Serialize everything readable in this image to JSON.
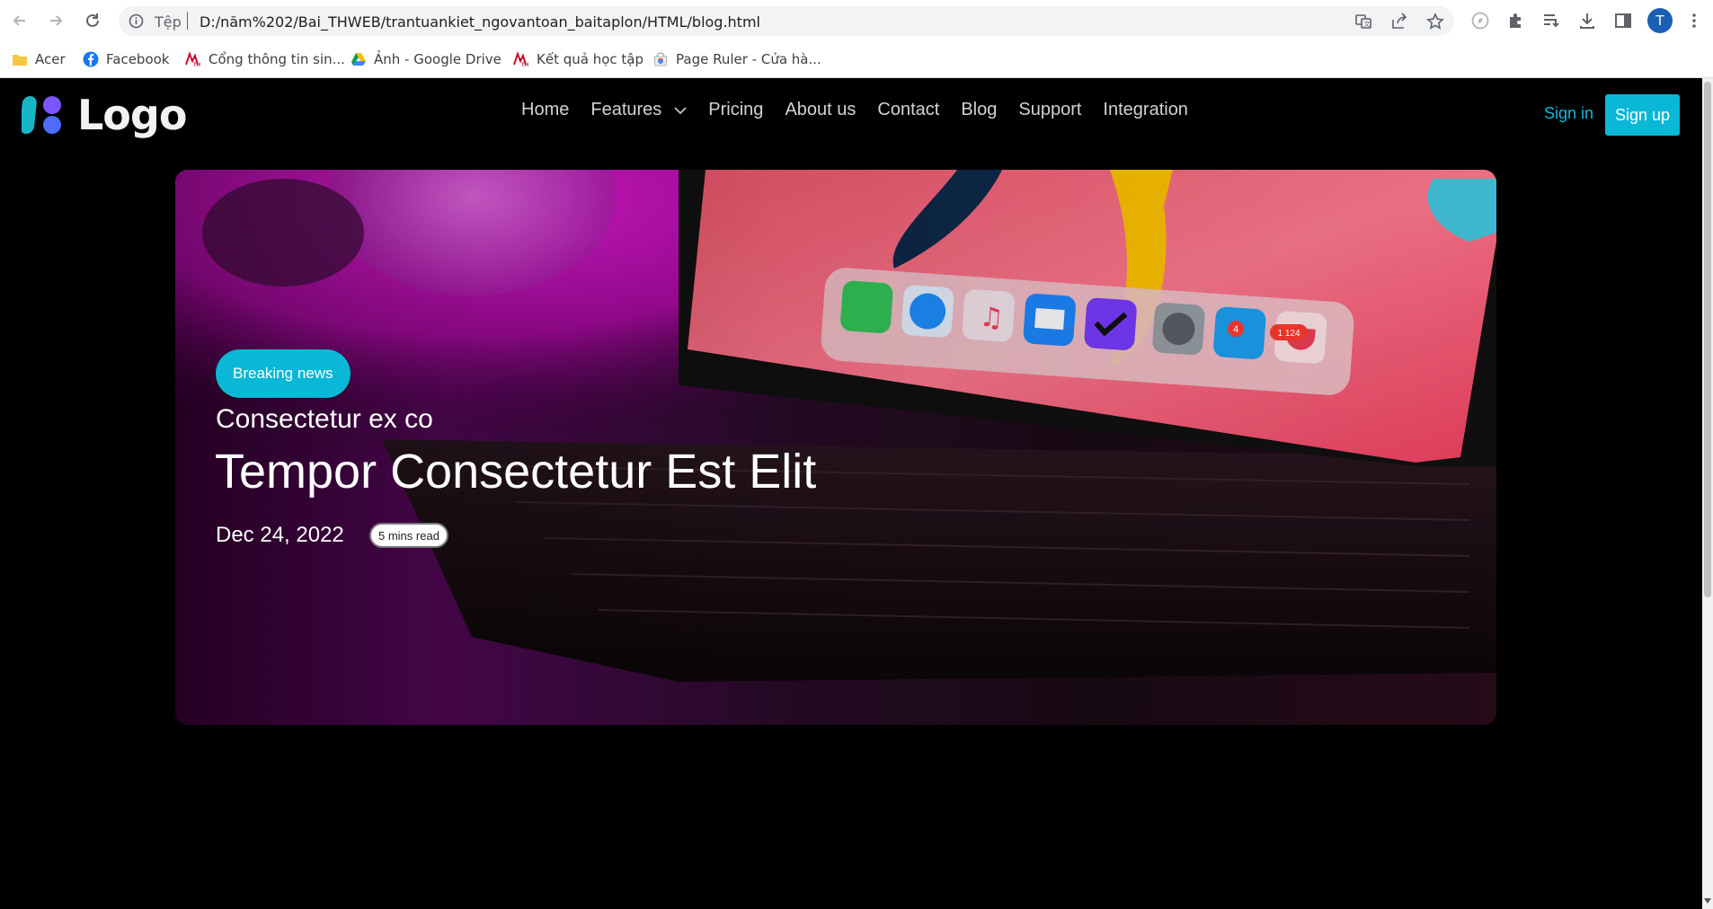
{
  "browser": {
    "scheme_label": "Tệp",
    "url": "D:/năm%202/Bai_THWEB/trantuankiet_ngovantoan_baitaplon/HTML/blog.html",
    "profile_initial": "T",
    "bookmarks": [
      {
        "label": "Acer",
        "icon": "folder-icon"
      },
      {
        "label": "Facebook",
        "icon": "facebook-icon"
      },
      {
        "label": "Cổng thông tin sin...",
        "icon": "university-icon"
      },
      {
        "label": "Ảnh - Google Drive",
        "icon": "google-drive-icon"
      },
      {
        "label": "Kết quả học tập",
        "icon": "university-icon"
      },
      {
        "label": "Page Ruler - Cửa hà...",
        "icon": "chrome-webstore-icon"
      }
    ]
  },
  "site": {
    "logo_text": "Logo",
    "nav": [
      {
        "label": "Home"
      },
      {
        "label": "Features",
        "has_dropdown": true
      },
      {
        "label": "Pricing"
      },
      {
        "label": "About us"
      },
      {
        "label": "Contact"
      },
      {
        "label": "Blog"
      },
      {
        "label": "Support"
      },
      {
        "label": "Integration"
      }
    ],
    "sign_in": "Sign in",
    "sign_up": "Sign up",
    "accent_color": "#08b8d6"
  },
  "hero": {
    "badge": "Breaking news",
    "subtitle": "Consectetur ex co",
    "title": "Tempor Consectetur Est Elit",
    "date": "Dec 24, 2022",
    "read_time": "5 mins read",
    "dock_badges": {
      "twitter": "4",
      "pocket": "1 124"
    }
  }
}
